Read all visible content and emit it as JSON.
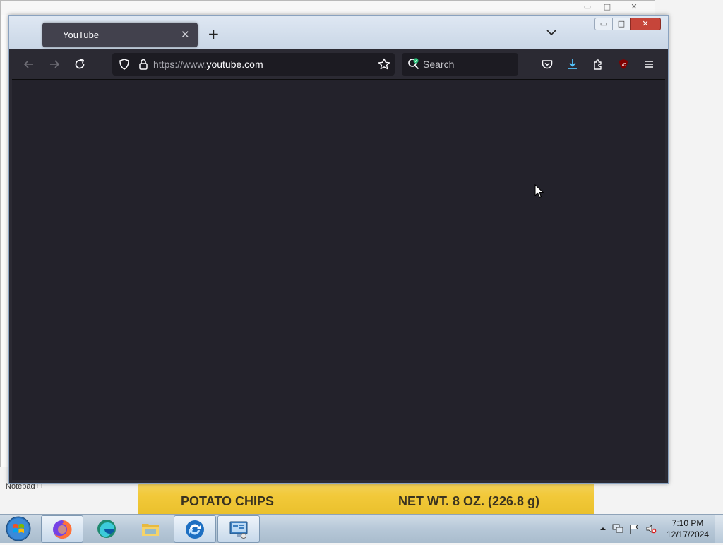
{
  "browser": {
    "tab": {
      "title": "YouTube",
      "close_glyph": "✕"
    },
    "new_tab_glyph": "+",
    "url": {
      "prefix": "https://www.",
      "host": "youtube.com"
    },
    "search": {
      "placeholder": "Search"
    },
    "window_controls": {
      "minimize": "▭",
      "maximize": "□",
      "close": "✕"
    }
  },
  "desktop": {
    "notepad_label": "Notepad++",
    "banner": {
      "left": "POTATO CHIPS",
      "right": "NET WT. 8 OZ. (226.8 g)"
    }
  },
  "taskbar": {
    "pinned": [
      "firefox-icon",
      "edge-icon",
      "file-explorer-icon",
      "sync-icon",
      "remote-desktop-icon"
    ],
    "clock": {
      "time": "7:10 PM",
      "date": "12/17/2024"
    }
  },
  "colors": {
    "toolbar_bg": "#2b2a33",
    "content_bg": "#23222b",
    "urlbar_bg": "#1c1b22",
    "download_accent": "#54ffbd",
    "ublock_red": "#800000"
  }
}
